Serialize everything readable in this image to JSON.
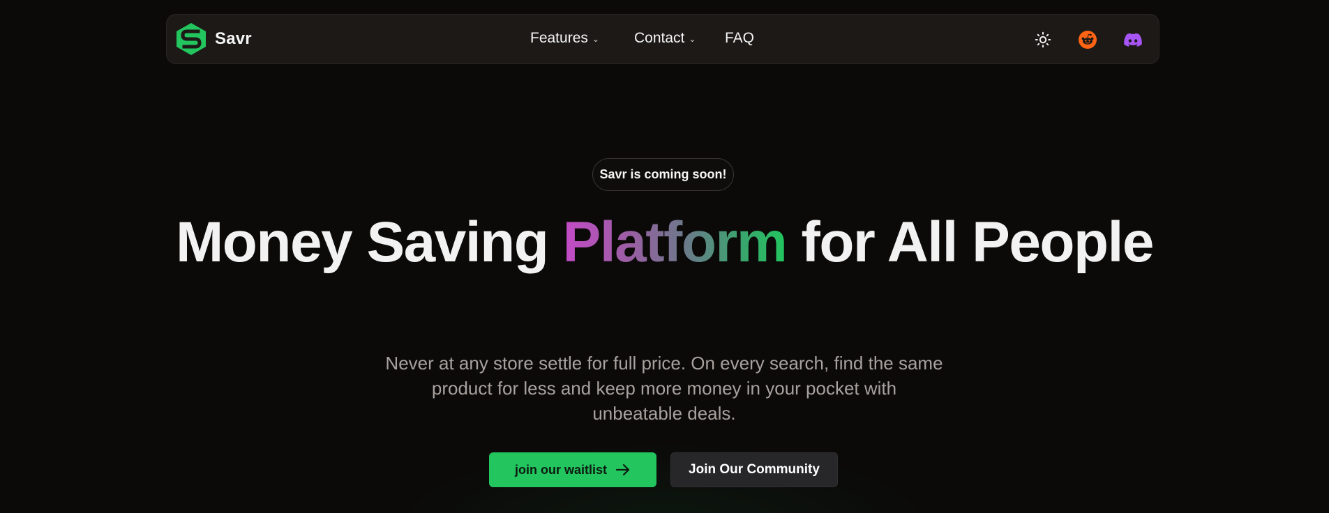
{
  "navbar": {
    "brand_name": "Savr",
    "links": [
      {
        "label": "Features",
        "has_dropdown": true
      },
      {
        "label": "Contact",
        "has_dropdown": true
      },
      {
        "label": "FAQ",
        "has_dropdown": false
      }
    ],
    "icons": [
      "sun-icon",
      "reddit-icon",
      "discord-icon"
    ]
  },
  "hero": {
    "badge": "Savr is coming soon!",
    "headline_before": "Money Saving ",
    "headline_highlight": "Platform",
    "headline_after": " for All People",
    "subtext": "Never at any store settle for full price. On every search, find the same product for less and keep more money in your pocket with unbeatable deals.",
    "primary_cta": "join our waitlist",
    "secondary_cta": "Join Our Community"
  },
  "colors": {
    "background": "#0b0a09",
    "navbar_bg": "#1c1917",
    "accent_green": "#22c55e",
    "reddit_orange": "#ff6314",
    "discord_purple": "#a855f7",
    "gradient_start": "#c44bc7",
    "gradient_end": "#22c55e",
    "muted_text": "#a8a29e",
    "secondary_button": "#27272a"
  }
}
